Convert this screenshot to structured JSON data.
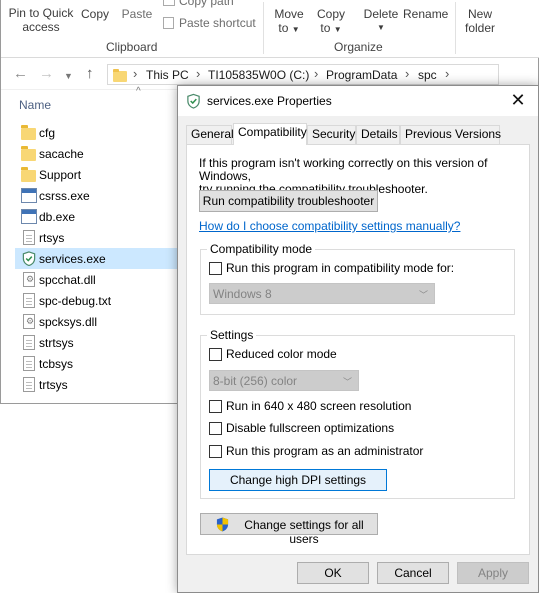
{
  "ribbon": {
    "pin_label_line1": "Pin to Quick",
    "pin_label_line2": "access",
    "copy_label": "Copy",
    "paste_label": "Paste",
    "copy_path_label": "Copy path",
    "paste_shortcut_label": "Paste shortcut",
    "clipboard_group": "Clipboard",
    "move_to_line1": "Move",
    "move_to_line2": "to",
    "copy_to_line1": "Copy",
    "copy_to_line2": "to",
    "delete_label": "Delete",
    "rename_label": "Rename",
    "organize_group": "Organize",
    "new_folder_line1": "New",
    "new_folder_line2": "folder"
  },
  "address": {
    "crumbs": [
      "This PC",
      "TI105835W0O (C:)",
      "ProgramData",
      "spc"
    ]
  },
  "files": {
    "column_name": "Name",
    "items": [
      {
        "name": "cfg",
        "type": "folder"
      },
      {
        "name": "sacache",
        "type": "folder"
      },
      {
        "name": "Support",
        "type": "folder"
      },
      {
        "name": "csrss.exe",
        "type": "exe"
      },
      {
        "name": "db.exe",
        "type": "exe"
      },
      {
        "name": "rtsys",
        "type": "file"
      },
      {
        "name": "services.exe",
        "type": "shield-exe",
        "selected": true
      },
      {
        "name": "spcchat.dll",
        "type": "dll"
      },
      {
        "name": "spc-debug.txt",
        "type": "file"
      },
      {
        "name": "spcksys.dll",
        "type": "dll"
      },
      {
        "name": "strtsys",
        "type": "file"
      },
      {
        "name": "tcbsys",
        "type": "file"
      },
      {
        "name": "trtsys",
        "type": "file"
      }
    ]
  },
  "dialog": {
    "title": "services.exe Properties",
    "tabs": [
      "General",
      "Compatibility",
      "Security",
      "Details",
      "Previous Versions"
    ],
    "active_tab": "Compatibility",
    "intro_line1": "If this program isn't working correctly on this version of Windows,",
    "intro_line2": "try running the compatibility troubleshooter.",
    "troubleshooter_button": "Run compatibility troubleshooter",
    "help_link": "How do I choose compatibility settings manually?",
    "compat_mode": {
      "group_title": "Compatibility mode",
      "checkbox_label": "Run this program in compatibility mode for:",
      "checked": false,
      "os_select_value": "Windows 8"
    },
    "settings": {
      "group_title": "Settings",
      "reduced_color_label": "Reduced color mode",
      "color_select_value": "8-bit (256) color",
      "resolution_label": "Run in 640 x 480 screen resolution",
      "fullscreen_label": "Disable fullscreen optimizations",
      "admin_label": "Run this program as an administrator",
      "dpi_button": "Change high DPI settings"
    },
    "all_users_button": "Change settings for all users",
    "ok_button": "OK",
    "cancel_button": "Cancel",
    "apply_button": "Apply"
  },
  "colors": {
    "selection": "#cce8ff",
    "link": "#0066cc",
    "focus_border": "#0078d7",
    "folder": "#f8d775"
  }
}
